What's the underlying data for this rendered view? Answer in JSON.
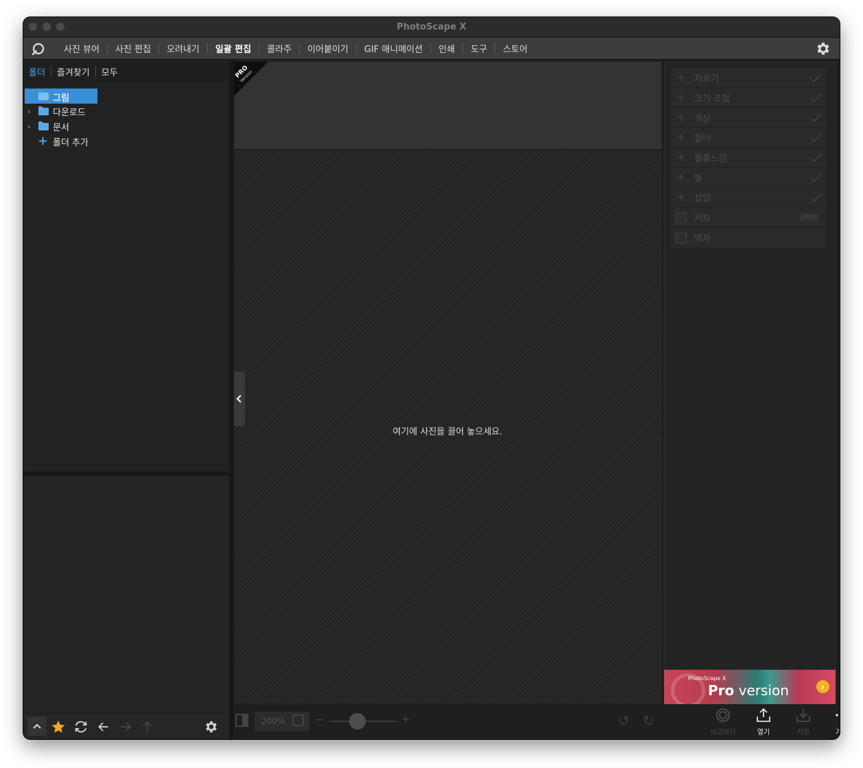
{
  "window": {
    "title": "PhotoScape X"
  },
  "menu": {
    "items": [
      "사진 뷰어",
      "사진 편집",
      "오려내기",
      "일괄 편집",
      "콜라주",
      "이어붙이기",
      "GIF 애니메이션",
      "인쇄",
      "도구",
      "스토어"
    ],
    "active": "일괄 편집"
  },
  "left_panel": {
    "tabs": [
      "폴더",
      "즐겨찾기",
      "모두"
    ],
    "active_tab": "폴더",
    "tree": [
      {
        "label": "그림",
        "selected": true,
        "expandable": false
      },
      {
        "label": "다운로드",
        "selected": false,
        "expandable": true
      },
      {
        "label": "문서",
        "selected": false,
        "expandable": true
      }
    ],
    "add_folder_label": "폴더 추가"
  },
  "center": {
    "pro_badge": "PRO",
    "pro_badge_sub": "Version",
    "drop_hint": "여기에 사진을 끌어 놓으세요.",
    "zoom": "200%"
  },
  "right_panel": {
    "tools": [
      {
        "label": "자르기",
        "kind": "plus"
      },
      {
        "label": "크기 조절",
        "kind": "plus"
      },
      {
        "label": "색상",
        "kind": "plus"
      },
      {
        "label": "필터",
        "kind": "plus"
      },
      {
        "label": "필름느낌",
        "kind": "plus"
      },
      {
        "label": "빛",
        "kind": "plus"
      },
      {
        "label": "삽입",
        "kind": "plus"
      },
      {
        "label": "커브",
        "kind": "checkbox",
        "badge": "PRO"
      },
      {
        "label": "액자",
        "kind": "checkbox"
      }
    ],
    "ad": {
      "small": "PhotoScape X",
      "big_bold": "Pro",
      "big_rest": " version"
    }
  },
  "bottom_actions": [
    {
      "label": "비교하기",
      "icon": "compare-icon",
      "enabled": false
    },
    {
      "label": "열기",
      "icon": "open-icon",
      "enabled": true
    },
    {
      "label": "저장",
      "icon": "save-icon",
      "enabled": false
    },
    {
      "label": "기타",
      "icon": "more-icon",
      "enabled": true
    }
  ],
  "colors": {
    "accent": "#3a8fd9",
    "favorite_star": "#f5a623",
    "ad_arrow": "#f0b61e"
  }
}
